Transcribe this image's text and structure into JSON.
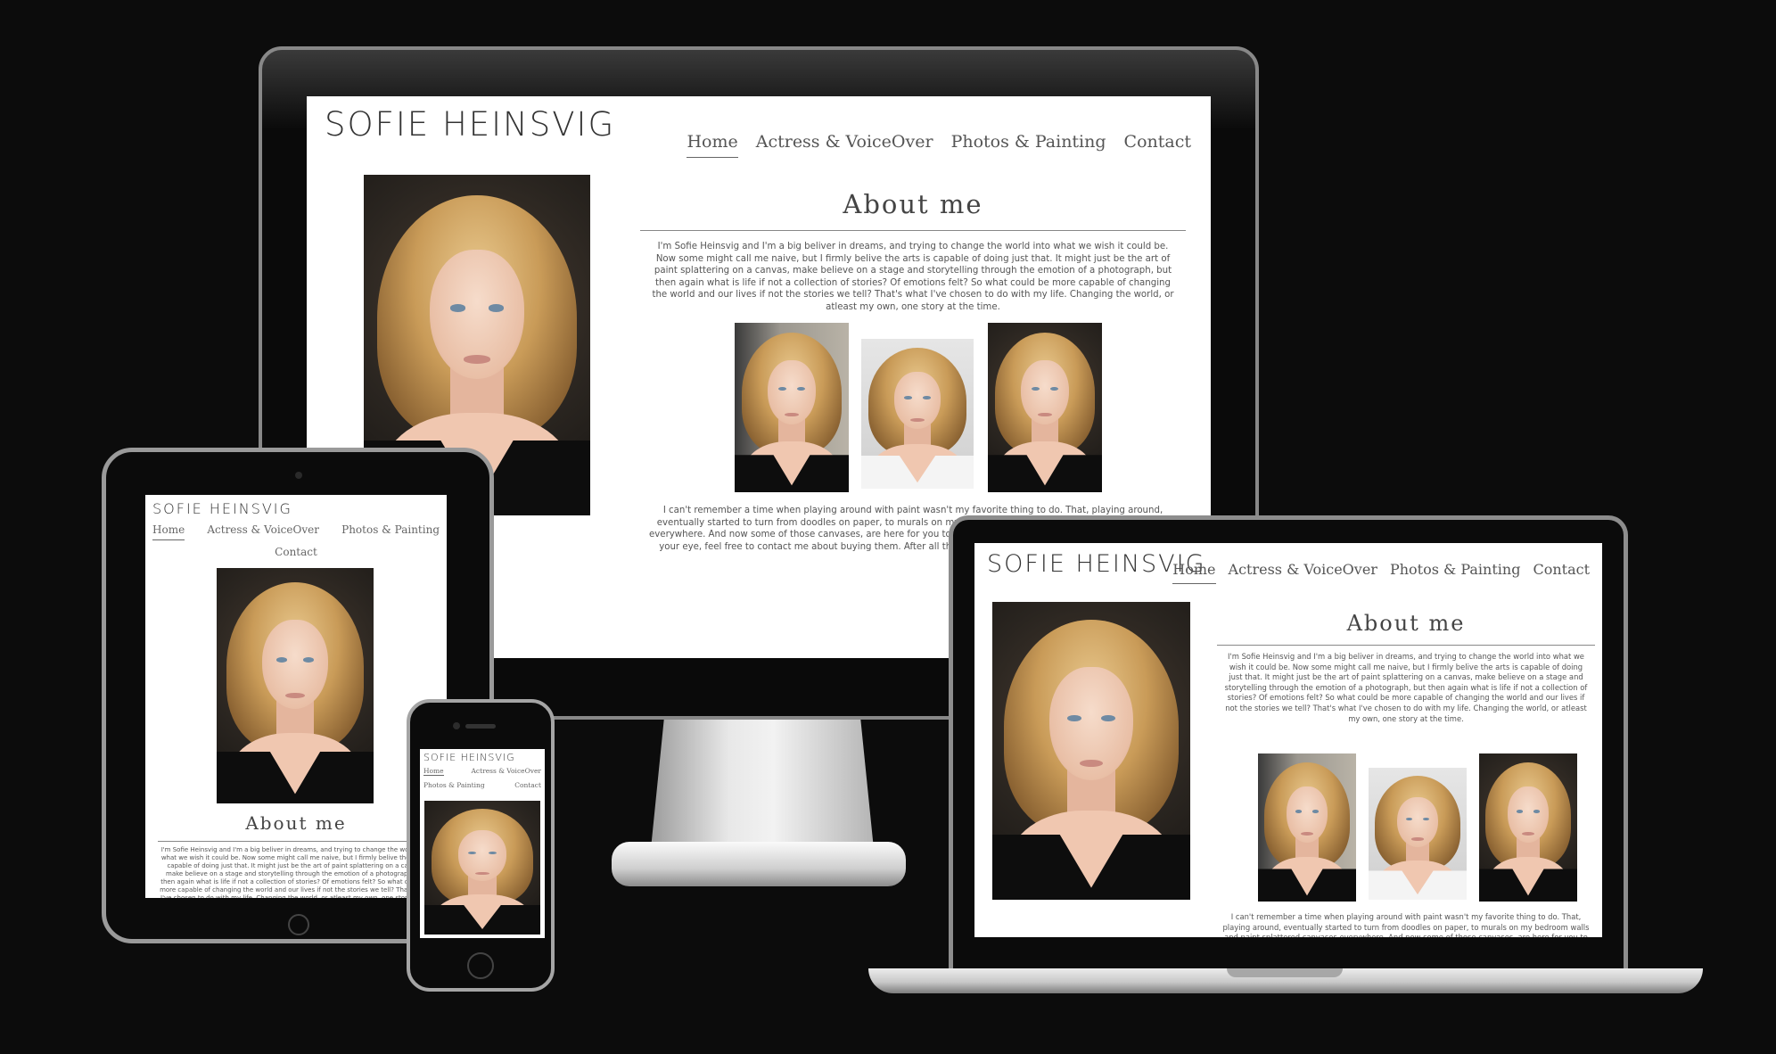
{
  "site": {
    "brand": "SOFIE HEINSVIG",
    "nav": {
      "home": "Home",
      "actress": "Actress & VoiceOver",
      "photos": "Photos & Painting",
      "contact": "Contact"
    },
    "about_title": "About me",
    "about_text": "I'm Sofie Heinsvig and I'm a big beliver in dreams, and trying to change the world into what we wish it could be. Now some might call me naive, but I firmly belive the arts is capable of doing just that. It might just be the art of paint splattering on a canvas, make believe on a stage and storytelling through the emotion of a photograph, but then again what is life if not a collection of stories? Of emotions felt? So what could be more capable of changing the world and our lives if not the stories we tell? That's what I've chosen to do with my life. Changing the world, or atleast my own, one story at the time.",
    "paint_text": "I can't remember a time when playing around with paint wasn't my favorite thing to do. That, playing around, eventually started to turn from doodles on paper, to murals on my bedroom walls and paint splattered canvases everywhere. And now some of those canvases, are here for you to look at! And should any of them happen to catch your eye, feel free to contact me about buying them. After all that would clear up more wall space in my home."
  },
  "devices": {
    "monitor": "desktop-monitor",
    "laptop": "laptop",
    "tablet": "tablet",
    "phone": "smartphone"
  },
  "colors": {
    "background": "#0c0c0c",
    "page": "#ffffff",
    "text": "#333333",
    "bezel": "#0b0b0b"
  }
}
